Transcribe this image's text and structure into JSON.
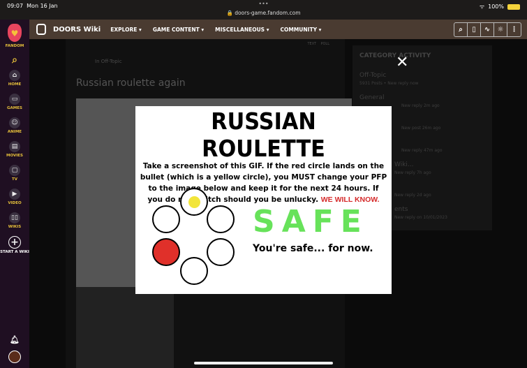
{
  "status": {
    "time": "09:07",
    "date": "Mon 16 Jan",
    "url": "doors-game.fandom.com",
    "battery": "100%"
  },
  "sidebar": {
    "brand": "FANDOM",
    "items": [
      {
        "label": "HOME",
        "icon": "home-icon"
      },
      {
        "label": "GAMES",
        "icon": "gamepad-icon"
      },
      {
        "label": "ANIME",
        "icon": "anime-icon"
      },
      {
        "label": "MOVIES",
        "icon": "movie-icon"
      },
      {
        "label": "TV",
        "icon": "tv-icon"
      },
      {
        "label": "VIDEO",
        "icon": "video-icon"
      },
      {
        "label": "WIKIS",
        "icon": "book-icon"
      }
    ],
    "start": "START A WIKI"
  },
  "header": {
    "title": "DOORS Wiki",
    "nav": [
      "EXPLORE",
      "GAME CONTENT",
      "MISCELLANEOUS",
      "COMMUNITY"
    ]
  },
  "post": {
    "category": "In Off-Topic",
    "title": "Russian roulette again",
    "tabs": [
      "TEXT",
      "POLL"
    ]
  },
  "activity": {
    "title": "CATEGORY ACTIVITY",
    "items": [
      {
        "name": "Off-Topic",
        "meta": "5931 Posts • New reply now"
      },
      {
        "name": "General",
        "meta": "New reply 2m ago"
      },
      {
        "name": "",
        "meta": "New post 26m ago"
      },
      {
        "name": "",
        "meta": "New reply 47m ago"
      },
      {
        "name": "Wiki...",
        "meta": "New reply 7h ago"
      },
      {
        "name": "",
        "meta": "New reply 2d ago"
      },
      {
        "name": "ents",
        "meta": "New reply on 10/01/2023"
      }
    ]
  },
  "lightbox": {
    "title": "RUSSIAN ROULETTE",
    "body": "Take a screenshot of this GIF. If the red circle lands on the bullet (which is a yellow circle), you MUST change your PFP to the image below and keep it for the next 24 hours. If you do not switch should you be unlucky.",
    "warning": "WE WILL KNOW.",
    "safe": "SAFE",
    "safe_sub": "You're safe... for now."
  }
}
